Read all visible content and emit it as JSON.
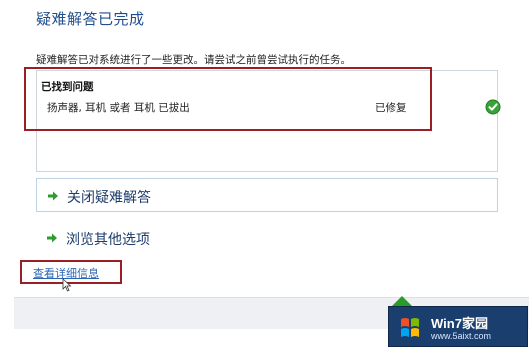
{
  "header": {
    "title": "疑难解答已完成"
  },
  "description": "疑难解答已对系统进行了一些更改。请尝试之前曾尝试执行的任务。",
  "results": {
    "heading": "已找到问题",
    "issues": [
      {
        "text": "扬声器, 耳机 或者 耳机 已拔出",
        "status": "已修复",
        "status_icon": "green-check-icon"
      }
    ]
  },
  "options": {
    "close_label": "关闭疑难解答",
    "browse_label": "浏览其他选项"
  },
  "details_link": "查看详细信息",
  "watermark": {
    "brand": "Win7家园",
    "url": "www.5aixt.com"
  },
  "colors": {
    "title": "#1f4e8c",
    "arrow": "#2e9b2e",
    "highlight": "#9a1f24",
    "link": "#2a66b8"
  }
}
